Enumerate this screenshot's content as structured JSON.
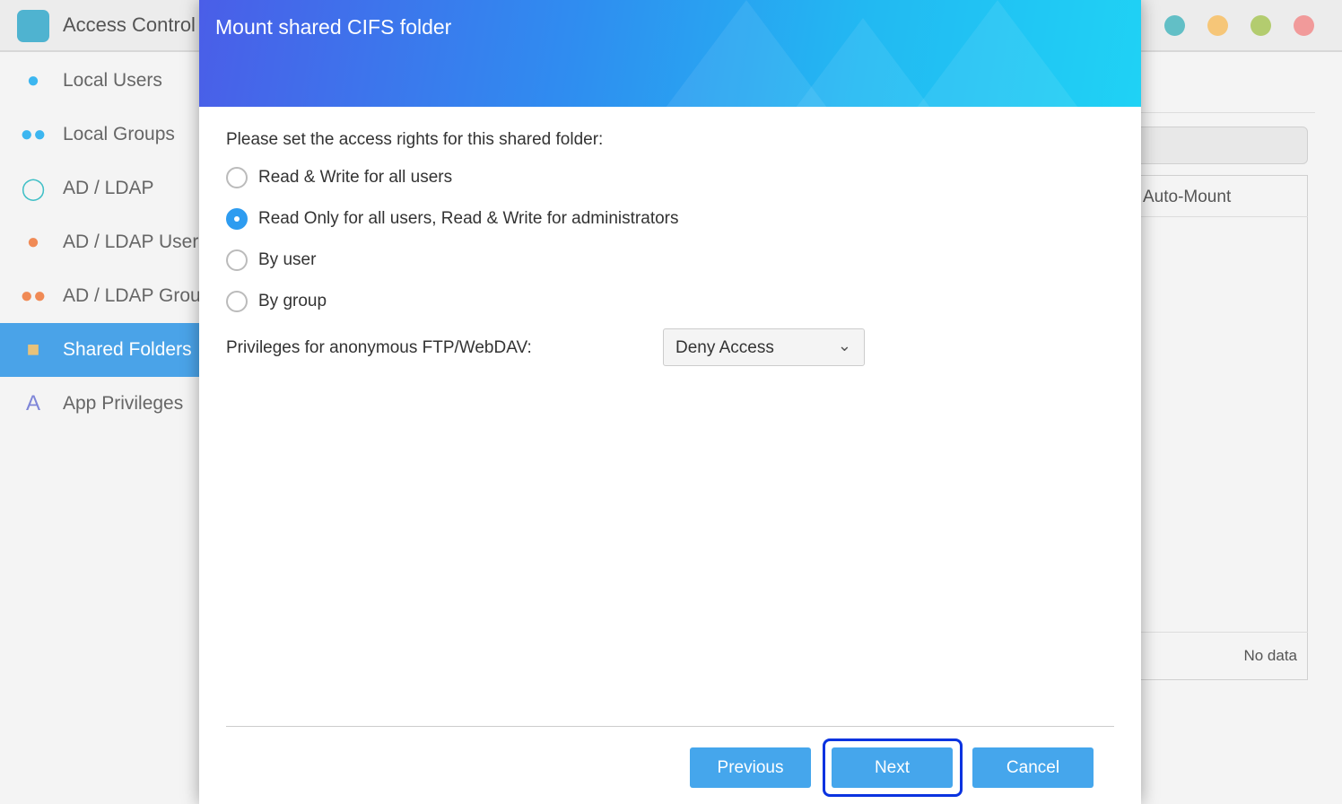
{
  "app": {
    "title": "Access Control",
    "window_buttons": [
      {
        "name": "minimize",
        "color": "#62bfc6"
      },
      {
        "name": "maximize",
        "color": "#f6c678"
      },
      {
        "name": "restore",
        "color": "#b3cc6f"
      },
      {
        "name": "close",
        "color": "#f19a9a"
      }
    ]
  },
  "sidebar": {
    "items": [
      {
        "label": "Local Users",
        "icon": "user-icon",
        "color": "#3cb6f0"
      },
      {
        "label": "Local Groups",
        "icon": "group-icon",
        "color": "#3cb6f0"
      },
      {
        "label": "AD / LDAP",
        "icon": "key-icon",
        "color": "#3fbfc6"
      },
      {
        "label": "AD / LDAP Users",
        "icon": "user-icon",
        "color": "#f08a55"
      },
      {
        "label": "AD / LDAP Groups",
        "icon": "group-icon",
        "color": "#f08a55"
      },
      {
        "label": "Shared Folders",
        "icon": "folder-icon",
        "color": "#e8c27a",
        "active": true
      },
      {
        "label": "App Privileges",
        "icon": "app-icon",
        "color": "#7f86d8"
      }
    ]
  },
  "background": {
    "column_header": "Auto-Mount",
    "no_data": "No data"
  },
  "dialog": {
    "title": "Mount shared CIFS folder",
    "intro": "Please set the access rights for this shared folder:",
    "options": [
      {
        "label": "Read & Write for all users",
        "selected": false
      },
      {
        "label": "Read Only for all users, Read & Write for administrators",
        "selected": true
      },
      {
        "label": "By user",
        "selected": false
      },
      {
        "label": "By group",
        "selected": false
      }
    ],
    "anon_label": "Privileges for anonymous FTP/WebDAV:",
    "anon_value": "Deny Access",
    "buttons": {
      "previous": "Previous",
      "next": "Next",
      "cancel": "Cancel"
    }
  }
}
